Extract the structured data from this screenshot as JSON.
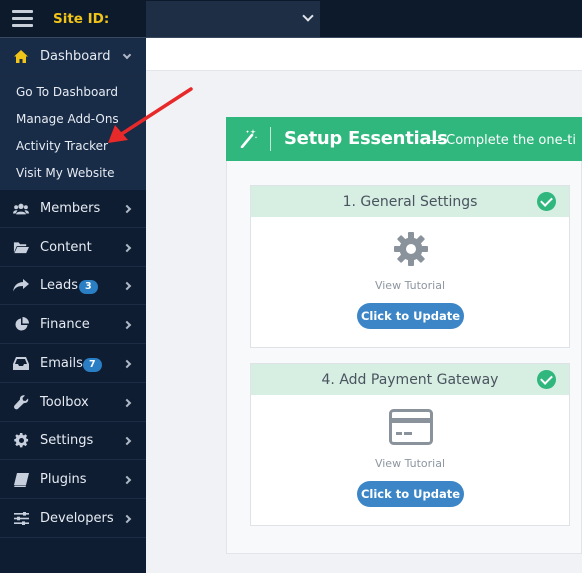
{
  "topbar": {
    "menu_icon": "hamburger-icon",
    "site_id_label": "Site ID:",
    "site_select_value": "",
    "select_icon": "chevron-down-icon"
  },
  "sidebar": {
    "items": [
      {
        "label": "Dashboard",
        "icon": "home-icon",
        "expanded": true
      },
      {
        "label": "Members",
        "icon": "users-icon"
      },
      {
        "label": "Content",
        "icon": "folder-icon"
      },
      {
        "label": "Leads",
        "icon": "share-icon",
        "badge": "3"
      },
      {
        "label": "Finance",
        "icon": "pie-chart-icon"
      },
      {
        "label": "Emails",
        "icon": "inbox-icon",
        "badge": "7"
      },
      {
        "label": "Toolbox",
        "icon": "wrench-icon"
      },
      {
        "label": "Settings",
        "icon": "gear-icon"
      },
      {
        "label": "Plugins",
        "icon": "book-icon"
      },
      {
        "label": "Developers",
        "icon": "sliders-icon"
      }
    ],
    "dashboard_submenu": [
      "Go To Dashboard",
      "Manage Add-Ons",
      "Activity Tracker",
      "Visit My Website"
    ]
  },
  "setup": {
    "title": "Setup Essentials",
    "subtitle": "— Complete the one-ti",
    "cards": [
      {
        "title": "1. General Settings",
        "icon": "gear-icon",
        "tutorial": "View Tutorial",
        "button": "Click to Update",
        "completed": true
      },
      {
        "title": "4. Add Payment Gateway",
        "icon": "credit-card-icon",
        "tutorial": "View Tutorial",
        "button": "Click to Update",
        "completed": true
      }
    ]
  },
  "colors": {
    "sidebar_bg": "#0f1d33",
    "accent_green": "#2fb77e",
    "button_blue": "#3c86c7",
    "site_id_yellow": "#f0c419",
    "annotation_red": "#e8292a"
  }
}
